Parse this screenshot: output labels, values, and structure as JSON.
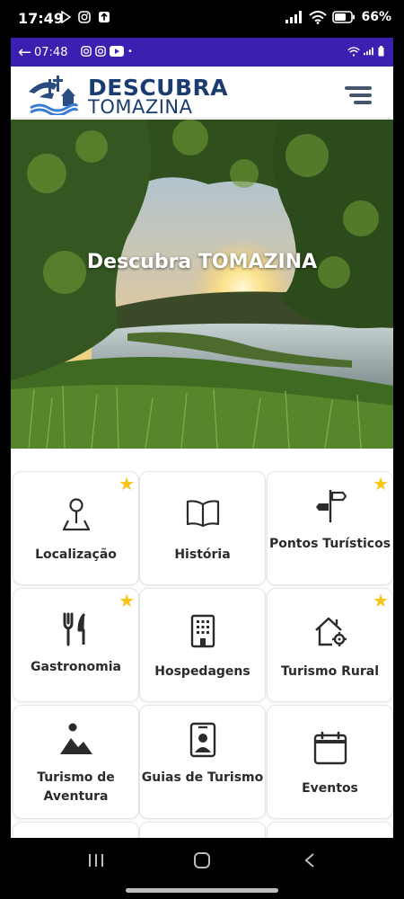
{
  "phone_status": {
    "time": "17:49",
    "battery": "66%"
  },
  "inner_status": {
    "time": "07:48"
  },
  "header": {
    "brand_top": "DESCUBRA",
    "brand_bottom": "TOMAZINA"
  },
  "hero": {
    "title": "Descubra TOMAZINA"
  },
  "cards": [
    {
      "label": "Localização",
      "icon": "map-pin-icon",
      "favorite": true
    },
    {
      "label": "História",
      "icon": "book-icon",
      "favorite": false
    },
    {
      "label": "Pontos Turísticos",
      "icon": "signpost-icon",
      "favorite": true
    },
    {
      "label": "Gastronomia",
      "icon": "utensils-icon",
      "favorite": true
    },
    {
      "label": "Hospedagens",
      "icon": "hotel-icon",
      "favorite": false
    },
    {
      "label": "Turismo Rural",
      "icon": "house-gear-icon",
      "favorite": true
    },
    {
      "label": "Turismo de Aventura",
      "icon": "landscape-icon",
      "favorite": false
    },
    {
      "label": "Guias de Turismo",
      "icon": "guide-badge-icon",
      "favorite": false
    },
    {
      "label": "Eventos",
      "icon": "calendar-icon",
      "favorite": false
    }
  ],
  "colors": {
    "brand": "#1b3c70",
    "status_bar": "#3b1fb0",
    "star": "#f5c518"
  }
}
